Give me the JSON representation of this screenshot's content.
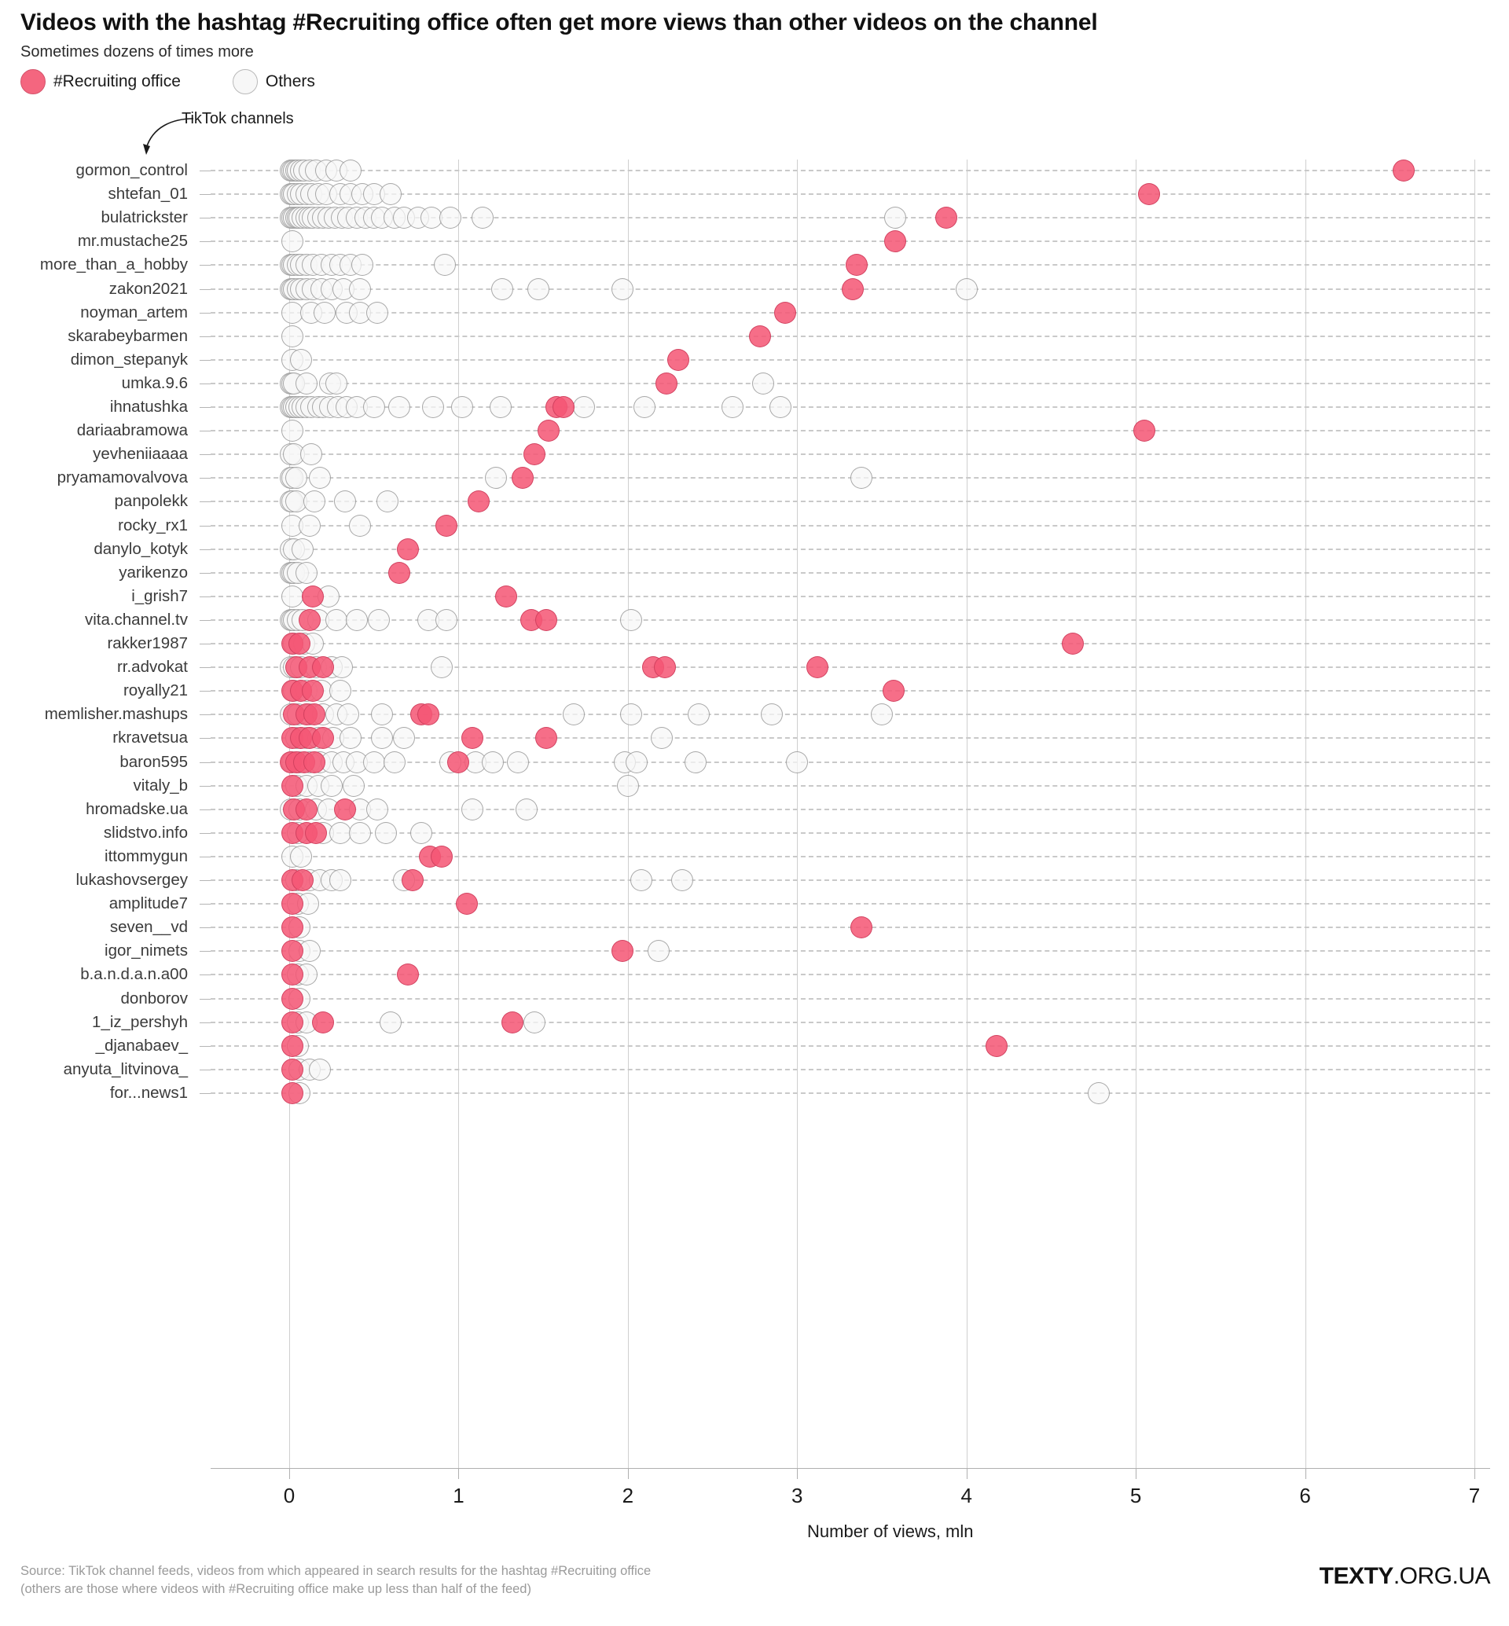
{
  "header": {
    "title": "Videos with the hashtag #Recruiting office often get more views than other videos on the channel",
    "subtitle": "Sometimes dozens of times more"
  },
  "legend": {
    "items": [
      {
        "label": "#Recruiting office",
        "color": "#f4667f",
        "key": "tag"
      },
      {
        "label": "Others",
        "color": "#f7f7f7",
        "key": "other"
      }
    ]
  },
  "annotation": {
    "label": "TikTok channels",
    "icon": "curved-arrow-icon"
  },
  "footer": {
    "line1": "Source: TikTok channel feeds, videos from which appeared in search results for the hashtag #Recruiting office",
    "line2": "(others are those where videos with #Recruiting office make up less than half of the feed)",
    "brand_bold": "TEXTY",
    "brand_rest": ".ORG.UA"
  },
  "chart_data": {
    "type": "scatter",
    "title": "Videos with the hashtag #Recruiting office often get more views than other videos on the channel",
    "subtitle": "Sometimes dozens of times more",
    "xlabel": "Number of views, mln",
    "ylabel": "",
    "xlim": [
      0,
      7
    ],
    "xticks": [
      0,
      1,
      2,
      3,
      4,
      5,
      6,
      7
    ],
    "xticklabels": [
      "0",
      "1",
      "2",
      "3",
      "4",
      "5",
      "6",
      "7"
    ],
    "grid": {
      "vertical": true,
      "horizontal": "dashed"
    },
    "legend_position": "top-left",
    "series": [
      {
        "name": "#Recruiting office",
        "color": "#f4667f"
      },
      {
        "name": "Others",
        "color": "#f7f7f7"
      }
    ],
    "categories": [
      "gormon_control",
      "shtefan_01",
      "bulatrickster",
      "mr.mustache25",
      "more_than_a_hobby",
      "zakon2021",
      "noyman_artem",
      "skarabeybarmen",
      "dimon_stepanyk",
      "umka.9.6",
      "ihnatushka",
      "dariaabramowa",
      "yevheniiaaaa",
      "pryamamovalvova",
      "panpolekk",
      "rocky_rx1",
      "danylo_kotyk",
      "yarikenzo",
      "i_grish7",
      "vita.channel.tv",
      "rakker1987",
      "rr.advokat",
      "royally21",
      "memlisher.mashups",
      "rkravetsua",
      "baron595",
      "vitaly_b",
      "hromadske.ua",
      "slidstvo.info",
      "ittommygun",
      "lukashovsergey",
      "amplitude7",
      "seven__vd",
      "igor_nimets",
      "b.a.n.d.a.n.a00",
      "donborov",
      "1_iz_pershyh",
      "_djanabaev_",
      "anyuta_litvinova_",
      "for...news1"
    ],
    "rows": [
      {
        "channel": "gormon_control",
        "tag": [
          6.58
        ],
        "other": [
          0.01,
          0.02,
          0.03,
          0.04,
          0.05,
          0.07,
          0.09,
          0.12,
          0.16,
          0.22,
          0.28,
          0.36
        ]
      },
      {
        "channel": "shtefan_01",
        "tag": [
          5.08
        ],
        "other": [
          0.01,
          0.02,
          0.03,
          0.05,
          0.07,
          0.1,
          0.13,
          0.17,
          0.22,
          0.3,
          0.36,
          0.43,
          0.5,
          0.6
        ]
      },
      {
        "channel": "bulatrickster",
        "tag": [
          3.88
        ],
        "other": [
          0.01,
          0.02,
          0.03,
          0.04,
          0.05,
          0.06,
          0.08,
          0.1,
          0.12,
          0.14,
          0.17,
          0.2,
          0.23,
          0.27,
          0.31,
          0.35,
          0.4,
          0.45,
          0.5,
          0.55,
          0.62,
          0.68,
          0.76,
          0.84,
          0.95,
          1.14,
          3.58
        ]
      },
      {
        "channel": "mr.mustache25",
        "tag": [
          3.58
        ],
        "other": [
          0.02
        ]
      },
      {
        "channel": "more_than_a_hobby",
        "tag": [
          3.35
        ],
        "other": [
          0.01,
          0.02,
          0.03,
          0.05,
          0.07,
          0.1,
          0.14,
          0.19,
          0.25,
          0.3,
          0.36,
          0.43,
          0.92
        ]
      },
      {
        "channel": "zakon2021",
        "tag": [
          3.33
        ],
        "other": [
          0.01,
          0.02,
          0.03,
          0.05,
          0.07,
          0.1,
          0.14,
          0.19,
          0.25,
          0.32,
          0.42,
          1.26,
          1.47,
          1.97,
          4.0
        ]
      },
      {
        "channel": "noyman_artem",
        "tag": [
          2.93
        ],
        "other": [
          0.02,
          0.13,
          0.21,
          0.34,
          0.42,
          0.52
        ]
      },
      {
        "channel": "skarabeybarmen",
        "tag": [
          2.78
        ],
        "other": [
          0.02
        ]
      },
      {
        "channel": "dimon_stepanyk",
        "tag": [
          2.3
        ],
        "other": [
          0.02,
          0.07
        ]
      },
      {
        "channel": "umka.9.6",
        "tag": [
          2.23
        ],
        "other": [
          0.01,
          0.02,
          0.03,
          0.1,
          0.24,
          0.28,
          2.8
        ]
      },
      {
        "channel": "ihnatushka",
        "tag": [
          1.58,
          1.62
        ],
        "other": [
          0.01,
          0.02,
          0.03,
          0.04,
          0.06,
          0.08,
          0.1,
          0.13,
          0.17,
          0.2,
          0.24,
          0.29,
          0.34,
          0.4,
          0.5,
          0.65,
          0.85,
          1.02,
          1.25,
          1.74,
          2.1,
          2.62,
          2.9
        ]
      },
      {
        "channel": "dariaabramowa",
        "tag": [
          1.53,
          5.05
        ],
        "other": [
          0.02
        ]
      },
      {
        "channel": "yevheniiaaaa",
        "tag": [
          1.45
        ],
        "other": [
          0.01,
          0.03,
          0.13
        ]
      },
      {
        "channel": "pryamamovalvova",
        "tag": [
          1.38
        ],
        "other": [
          0.01,
          0.02,
          0.04,
          0.18,
          1.22,
          3.38
        ]
      },
      {
        "channel": "panpolekk",
        "tag": [
          1.12
        ],
        "other": [
          0.01,
          0.02,
          0.04,
          0.15,
          0.33,
          0.58
        ]
      },
      {
        "channel": "rocky_rx1",
        "tag": [
          0.93
        ],
        "other": [
          0.02,
          0.12,
          0.42
        ]
      },
      {
        "channel": "danylo_kotyk",
        "tag": [
          0.7
        ],
        "other": [
          0.01,
          0.03,
          0.08
        ]
      },
      {
        "channel": "yarikenzo",
        "tag": [
          0.65
        ],
        "other": [
          0.01,
          0.02,
          0.03,
          0.05,
          0.1
        ]
      },
      {
        "channel": "i_grish7",
        "tag": [
          0.14,
          1.28
        ],
        "other": [
          0.02,
          0.23
        ]
      },
      {
        "channel": "vita.channel.tv",
        "tag": [
          0.12,
          1.43,
          1.52
        ],
        "other": [
          0.01,
          0.02,
          0.03,
          0.05,
          0.08,
          0.17,
          0.28,
          0.4,
          0.53,
          0.82,
          0.93,
          2.02
        ]
      },
      {
        "channel": "rakker1987",
        "tag": [
          0.02,
          0.06,
          4.63
        ],
        "other": [
          0.03,
          0.09,
          0.14
        ]
      },
      {
        "channel": "rr.advokat",
        "tag": [
          0.04,
          0.12,
          0.2,
          2.15,
          2.22,
          3.12
        ],
        "other": [
          0.01,
          0.03,
          0.07,
          0.16,
          0.25,
          0.31,
          0.9
        ]
      },
      {
        "channel": "royally21",
        "tag": [
          0.02,
          0.07,
          0.14,
          3.57
        ],
        "other": [
          0.03,
          0.1,
          0.19,
          0.3
        ]
      },
      {
        "channel": "memlisher.mashups",
        "tag": [
          0.03,
          0.1,
          0.15,
          0.78,
          0.82
        ],
        "other": [
          0.01,
          0.05,
          0.12,
          0.2,
          0.28,
          0.35,
          0.55,
          1.68,
          2.02,
          2.42,
          2.85,
          3.5
        ]
      },
      {
        "channel": "rkravetsua",
        "tag": [
          0.02,
          0.07,
          0.12,
          0.2,
          1.08,
          1.52
        ],
        "other": [
          0.04,
          0.1,
          0.17,
          0.26,
          0.36,
          0.55,
          0.68,
          2.2
        ]
      },
      {
        "channel": "baron595",
        "tag": [
          0.01,
          0.04,
          0.09,
          0.15,
          1.0
        ],
        "other": [
          0.02,
          0.06,
          0.12,
          0.18,
          0.25,
          0.32,
          0.4,
          0.5,
          0.62,
          0.95,
          1.1,
          1.2,
          1.35,
          1.98,
          2.05,
          2.4,
          3.0
        ]
      },
      {
        "channel": "vitaly_b",
        "tag": [
          0.02
        ],
        "other": [
          0.04,
          0.1,
          0.17,
          0.25,
          0.38,
          2.0
        ]
      },
      {
        "channel": "hromadske.ua",
        "tag": [
          0.03,
          0.1,
          0.33
        ],
        "other": [
          0.01,
          0.06,
          0.16,
          0.23,
          0.42,
          0.52,
          1.08,
          1.4
        ]
      },
      {
        "channel": "slidstvo.info",
        "tag": [
          0.02,
          0.1,
          0.16
        ],
        "other": [
          0.05,
          0.2,
          0.3,
          0.42,
          0.57,
          0.78
        ]
      },
      {
        "channel": "ittommygun",
        "tag": [
          0.83,
          0.9
        ],
        "other": [
          0.02,
          0.07
        ]
      },
      {
        "channel": "lukashovsergey",
        "tag": [
          0.02,
          0.08,
          0.73
        ],
        "other": [
          0.04,
          0.12,
          0.18,
          0.25,
          0.3,
          0.68,
          2.08,
          2.32
        ]
      },
      {
        "channel": "amplitude7",
        "tag": [
          0.02,
          1.05
        ],
        "other": [
          0.05,
          0.11
        ]
      },
      {
        "channel": "seven__vd",
        "tag": [
          0.02,
          3.38
        ],
        "other": [
          0.06
        ]
      },
      {
        "channel": "igor_nimets",
        "tag": [
          0.02,
          1.97
        ],
        "other": [
          0.06,
          0.12,
          2.18
        ]
      },
      {
        "channel": "b.a.n.d.a.n.a00",
        "tag": [
          0.02,
          0.7
        ],
        "other": [
          0.05,
          0.1
        ]
      },
      {
        "channel": "donborov",
        "tag": [
          0.02
        ],
        "other": [
          0.06
        ]
      },
      {
        "channel": "1_iz_pershyh",
        "tag": [
          0.02,
          0.2,
          1.32
        ],
        "other": [
          0.05,
          0.1,
          0.6,
          1.45
        ]
      },
      {
        "channel": "_djanabaev_",
        "tag": [
          0.02,
          4.18
        ],
        "other": [
          0.05
        ]
      },
      {
        "channel": "anyuta_litvinova_",
        "tag": [
          0.02
        ],
        "other": [
          0.06,
          0.12,
          0.18
        ]
      },
      {
        "channel": "for...news1",
        "tag": [
          0.02
        ],
        "other": [
          0.06,
          4.78
        ]
      }
    ]
  }
}
